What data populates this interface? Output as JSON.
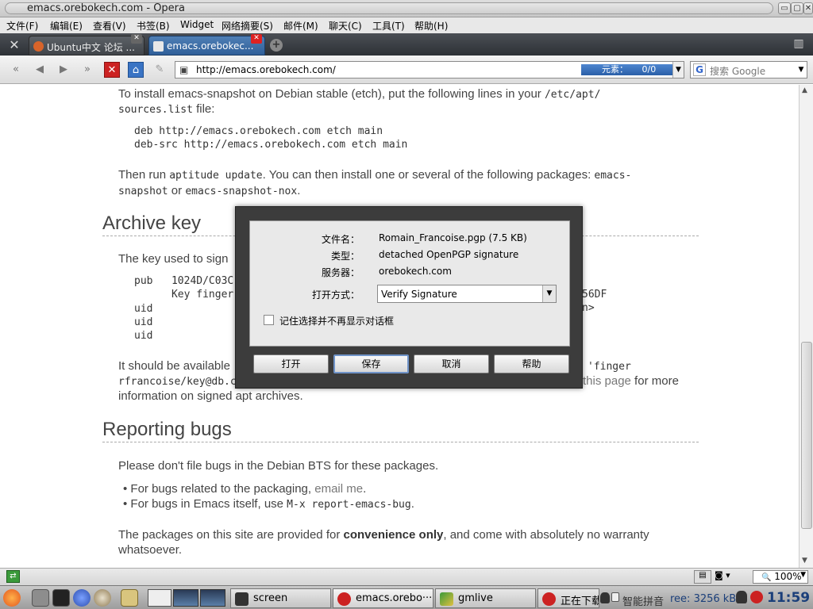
{
  "window": {
    "title": "emacs.orebokech.com - Opera",
    "buttons": [
      "▭",
      "▢",
      "✕"
    ]
  },
  "menubar": {
    "items": [
      "文件(F)",
      "编辑(E)",
      "查看(V)",
      "书签(B)",
      "Widget",
      "网络摘要(S)",
      "邮件(M)",
      "聊天(C)",
      "工具(T)",
      "帮助(H)"
    ]
  },
  "tabs": [
    {
      "label": "Ubuntu中文 论坛 ...",
      "active": false
    },
    {
      "label": "emacs.orebokec...",
      "active": true
    }
  ],
  "navbar": {
    "url": "http://emacs.orebokech.com/",
    "elements_label": "元素：",
    "elements_count": "0/0",
    "search_placeholder": "搜索 Google"
  },
  "page": {
    "intro_line1_a": "To install emacs-snapshot on Debian stable (etch), put the following lines in your ",
    "intro_line1_code": "/etc/apt/",
    "intro_line2_code": "sources.list",
    "intro_line2_b": " file:",
    "deb_lines": "deb http://emacs.orebokech.com etch main\ndeb-src http://emacs.orebokech.com etch main",
    "then_a": "Then run ",
    "then_code": "aptitude update",
    "then_b": ". You can then install one or several of the following packages: ",
    "then_code2": "emacs-",
    "then_line2_code": "snapshot",
    "then_line2_or": " or ",
    "then_line2_code2": "emacs-snapshot-nox",
    "then_line2_end": ".",
    "archive_heading": "Archive key",
    "archive_intro": "The key used to sign",
    "key_block_1": "pub   1024D/C03C",
    "key_block_2": "      Key finger",
    "key_block_uid": "uid\nuid\nuid",
    "key_right_1": "56DF",
    "key_right_2": "n>",
    "available_a": "It should be available",
    "available_code_right": "'finger",
    "available_line2_code": "rfrancoise/key@db.c",
    "available_line2_link": "this page",
    "available_line2_end": " for more",
    "available_line3": "information on signed apt archives.",
    "reporting_heading": "Reporting bugs",
    "reporting_intro": "Please don't file bugs in the Debian BTS for these packages.",
    "bullet1_a": "For bugs related to the packaging, ",
    "bullet1_link": "email me",
    "bullet1_end": ".",
    "bullet2_a": "For bugs in Emacs itself, use ",
    "bullet2_code": "M-x report-emacs-bug",
    "bullet2_end": ".",
    "conv_a": "The packages on this site are provided for ",
    "conv_bold": "convenience only",
    "conv_b": ", and come with absolutely no warranty",
    "conv_line2": "whatsoever."
  },
  "dialog": {
    "filename_label": "文件名：",
    "filename_value": "Romain_Francoise.pgp (7.5 KB)",
    "type_label": "类型：",
    "type_value": "detached OpenPGP signature",
    "server_label": "服务器：",
    "server_value": "orebokech.com",
    "open_with_label": "打开方式：",
    "open_with_value": "Verify Signature",
    "remember_label": "记住选择并不再显示对话框",
    "remember_checked": false,
    "buttons": {
      "open": "打开",
      "save": "保存",
      "cancel": "取消",
      "help": "帮助"
    }
  },
  "statusbar": {
    "zoom": "100%"
  },
  "taskbar": {
    "tasks": [
      "screen",
      "emacs.orebo···",
      "gmlive",
      "正在下载"
    ],
    "ime": "智能拼音",
    "free_text": "ree: 3256 kB",
    "clock": "11:59"
  }
}
